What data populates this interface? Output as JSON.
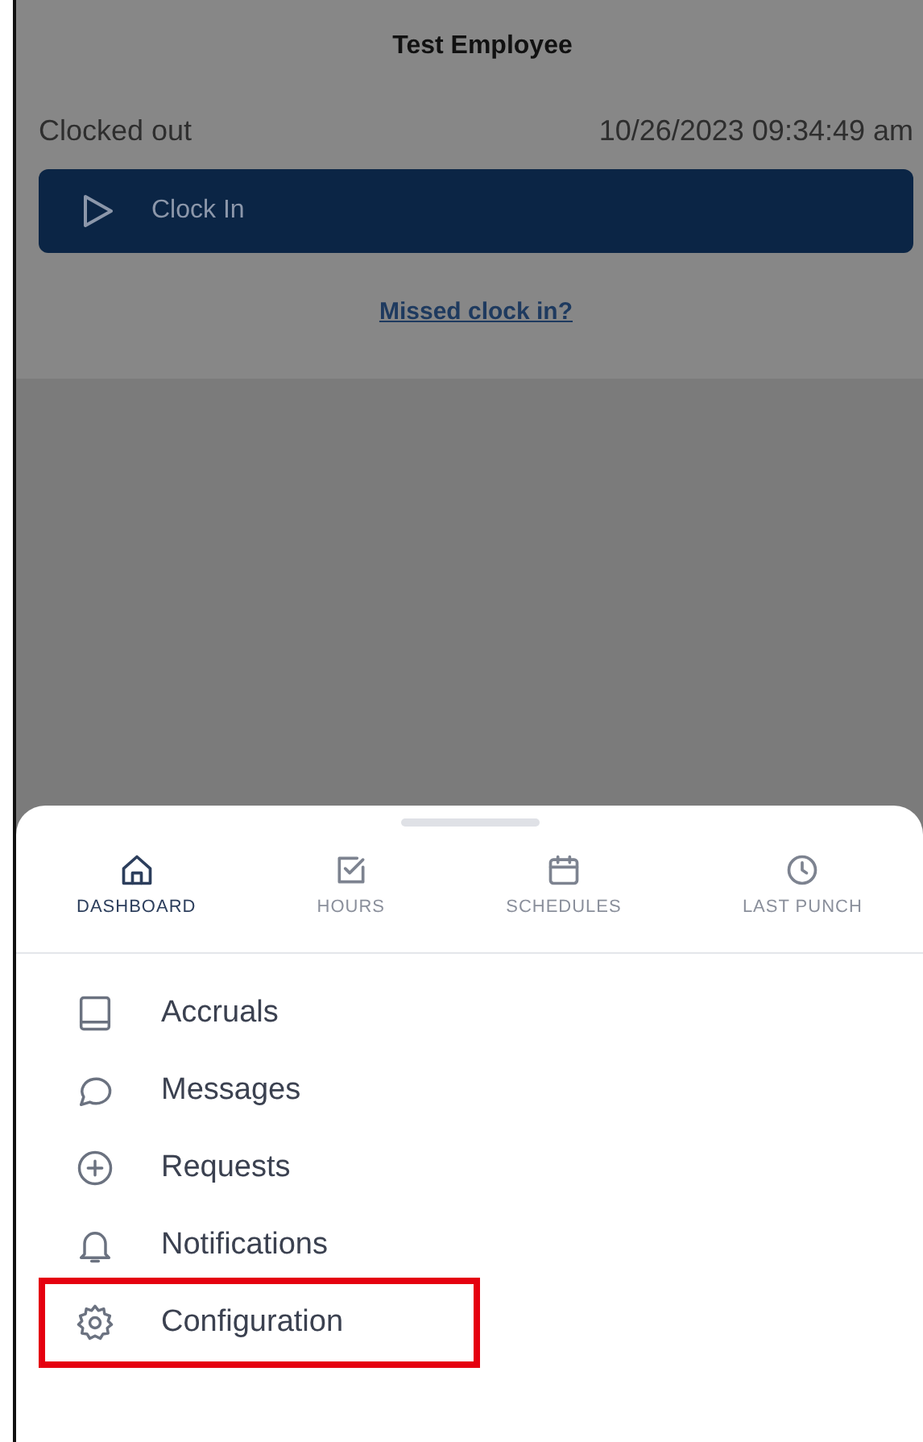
{
  "header": {
    "title": "Test Employee",
    "status": "Clocked out",
    "timestamp": "10/26/2023 09:34:49 am",
    "clock_button": "Clock In",
    "missed_link": "Missed clock in?"
  },
  "tabs": [
    {
      "label": "DASHBOARD",
      "kind": "home",
      "selected": true
    },
    {
      "label": "HOURS",
      "kind": "check",
      "selected": false
    },
    {
      "label": "SCHEDULES",
      "kind": "calendar",
      "selected": false
    },
    {
      "label": "LAST PUNCH",
      "kind": "clock",
      "selected": false
    }
  ],
  "menu": [
    {
      "label": "Accruals",
      "kind": "book",
      "highlighted": false
    },
    {
      "label": "Messages",
      "kind": "chat",
      "highlighted": false
    },
    {
      "label": "Requests",
      "kind": "plus",
      "highlighted": false
    },
    {
      "label": "Notifications",
      "kind": "bell",
      "highlighted": false
    },
    {
      "label": "Configuration",
      "kind": "gear",
      "highlighted": true
    }
  ]
}
